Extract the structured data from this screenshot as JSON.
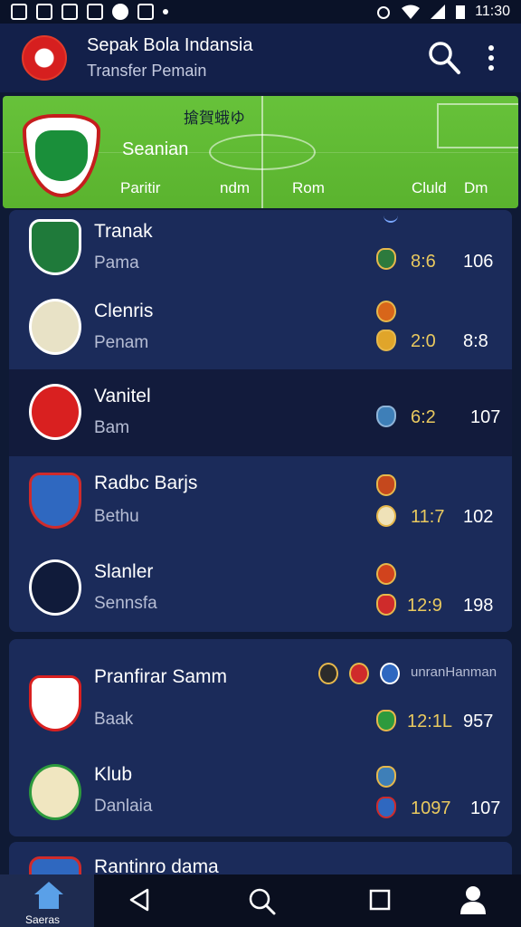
{
  "status_bar": {
    "time": "11:30"
  },
  "app_bar": {
    "title": "Sepak Bola Indansia",
    "subtitle": "Transfer Pemain",
    "icons": [
      "search-icon",
      "more-vert-icon"
    ]
  },
  "header_card": {
    "top_text": "搶賀蛾ゆ",
    "club_name": "Seanian",
    "columns": [
      "Paritir",
      "ndm",
      "Rom",
      "Cluld",
      "Dm"
    ],
    "colors": {
      "pitch": "#5ab32e",
      "crest_border": "#c51d1d"
    }
  },
  "transfers": [
    {
      "name": "Tranak",
      "sub": "Pama",
      "score": "8:6",
      "num": "106"
    },
    {
      "name": "Clenris",
      "sub": "Penam",
      "score": "2:0",
      "num": "8:8"
    },
    {
      "name": "Vanitel",
      "sub": "Bam",
      "score": "6:2",
      "num": "107"
    },
    {
      "name": "Radbc Barjs",
      "sub": "Bethu",
      "score": "11:7",
      "num": "102"
    },
    {
      "name": "Slanler",
      "sub": "Sennsfa",
      "score": "12:9",
      "num": "198"
    },
    {
      "name": "Pranfirar Samm",
      "sub": "Baak",
      "score": "12:1L",
      "num": "957",
      "extra": "unranHanman"
    },
    {
      "name": "Klub",
      "sub": "Danlaia",
      "score": "1097",
      "num": "107"
    },
    {
      "name": "Rantinro dama",
      "sub": "",
      "score": "",
      "num": ""
    }
  ],
  "bottom_nav": {
    "home_label": "Saeras",
    "icons": [
      "home-icon",
      "back-icon",
      "search-icon",
      "square-icon",
      "profile-icon"
    ]
  },
  "colors": {
    "background": "#0f1a35",
    "card": "#1b2b5a",
    "accent_score": "#e9c95f"
  }
}
